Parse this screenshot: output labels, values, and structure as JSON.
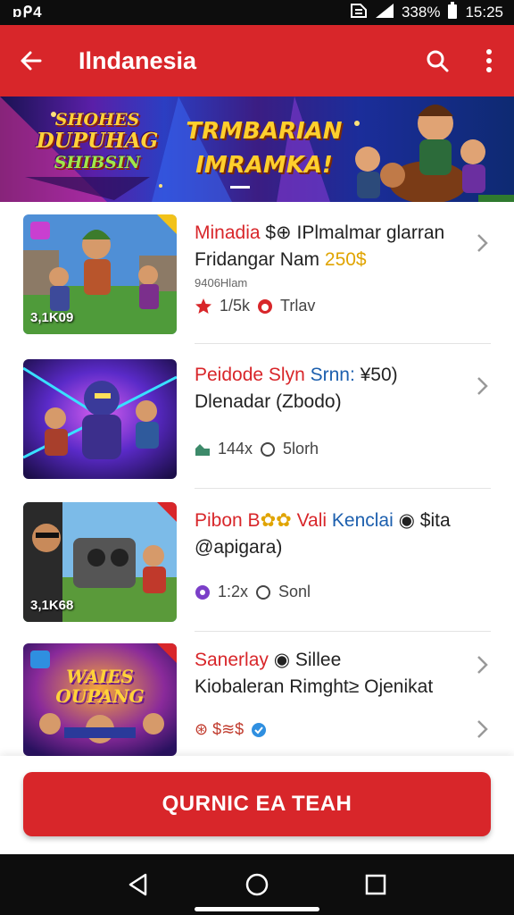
{
  "status_bar": {
    "left_text": "ɒᑭ4",
    "battery": "338%",
    "time": "15:25"
  },
  "app_bar": {
    "title": "Ilndanesia"
  },
  "banner": {
    "logo_lines": [
      "SHOHES",
      "DUPUHAG",
      "SHIBSIN"
    ],
    "headline_lines": [
      "TRMBARIAN",
      "IMRAMKA!"
    ]
  },
  "items": [
    {
      "line1_red": "Minadia",
      "line1_rest": " $⊕ IPlmalmar glarran",
      "line2": "Fridangar Nam ",
      "line2_gold": "250$",
      "line3": "9406Hlam",
      "meta_a": "1/5k",
      "meta_b": "Trlav",
      "thumb_count": "3,1K09",
      "meta_a_icon": "star-icon",
      "meta_b_icon": "fire-icon"
    },
    {
      "line1_red": "Peidode Slyn",
      "line1_blue": " Srnn:",
      "line1_rest": " ¥50)",
      "line2": "Dlenadar (Zbodo)",
      "line3": "",
      "meta_a": "144x",
      "meta_b": "5lorh",
      "thumb_count": "",
      "meta_a_icon": "trend-icon",
      "meta_b_icon": "circle-icon"
    },
    {
      "line1_red": "Pibon B",
      "line1_gold": "✿✿",
      "line1_rest2": " Vali ",
      "line1_blue": "Kenclai",
      "line1_rest": " ◉ $ita",
      "line2": "@apigara)",
      "line3": "",
      "meta_a": "1:2x",
      "meta_b": "Sonl",
      "thumb_count": "3,1K68",
      "meta_a_icon": "shield-icon",
      "meta_b_icon": "circle-icon"
    },
    {
      "line1_red": "Sanerlay",
      "line1_rest": " ◉ Sillee",
      "line2": "Kiobaleran Rimght≥ Ojenikat",
      "line3": "",
      "meta_a": "⊛ $≋$",
      "meta_b": "",
      "thumb_count": "",
      "meta_a_icon": "badge-icon"
    }
  ],
  "thumb_art": [
    {
      "logo_text": ""
    },
    {
      "logo_text": ""
    },
    {
      "logo_text": ""
    },
    {
      "logo_lines": [
        "WAIES",
        "OUPANG"
      ]
    }
  ],
  "cta": {
    "label": "QURNIC EA TEAH"
  },
  "colors": {
    "brand_red": "#d8262a",
    "gold": "#e0a400",
    "link_blue": "#1c5fae"
  }
}
